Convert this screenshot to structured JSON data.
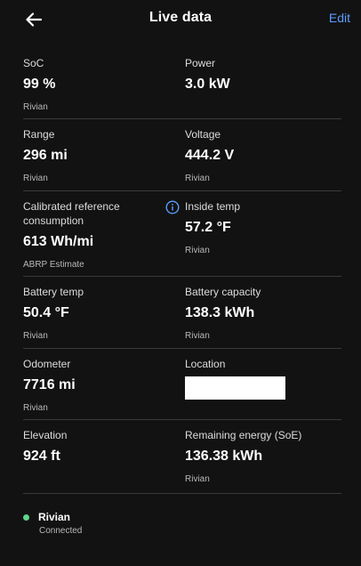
{
  "header": {
    "title": "Live data",
    "edit_label": "Edit"
  },
  "rows": [
    {
      "left": {
        "label": "SoC",
        "value": "99 %",
        "source": "Rivian"
      },
      "right": {
        "label": "Power",
        "value": "3.0 kW",
        "source": ""
      }
    },
    {
      "left": {
        "label": "Range",
        "value": "296 mi",
        "source": "Rivian"
      },
      "right": {
        "label": "Voltage",
        "value": "444.2 V",
        "source": "Rivian"
      }
    },
    {
      "left": {
        "label_line1": "Calibrated reference",
        "label_line2": "consumption",
        "value": "613 Wh/mi",
        "source": "ABRP Estimate"
      },
      "right": {
        "label": "Inside temp",
        "value": "57.2 °F",
        "source": "Rivian"
      }
    },
    {
      "left": {
        "label": "Battery temp",
        "value": "50.4 °F",
        "source": "Rivian"
      },
      "right": {
        "label": "Battery capacity",
        "value": "138.3 kWh",
        "source": "Rivian"
      }
    },
    {
      "left": {
        "label": "Odometer",
        "value": "7716 mi",
        "source": "Rivian"
      },
      "right": {
        "label": "Location"
      }
    },
    {
      "left": {
        "label": "Elevation",
        "value": "924 ft",
        "source": ""
      },
      "right": {
        "label": "Remaining energy (SoE)",
        "value": "136.38 kWh",
        "source": "Rivian"
      }
    }
  ],
  "footer": {
    "name": "Rivian",
    "status": "Connected",
    "status_color": "#5fd48a"
  },
  "colors": {
    "background": "#121212",
    "accent": "#5c9dff",
    "divider": "#3a3a3a"
  }
}
